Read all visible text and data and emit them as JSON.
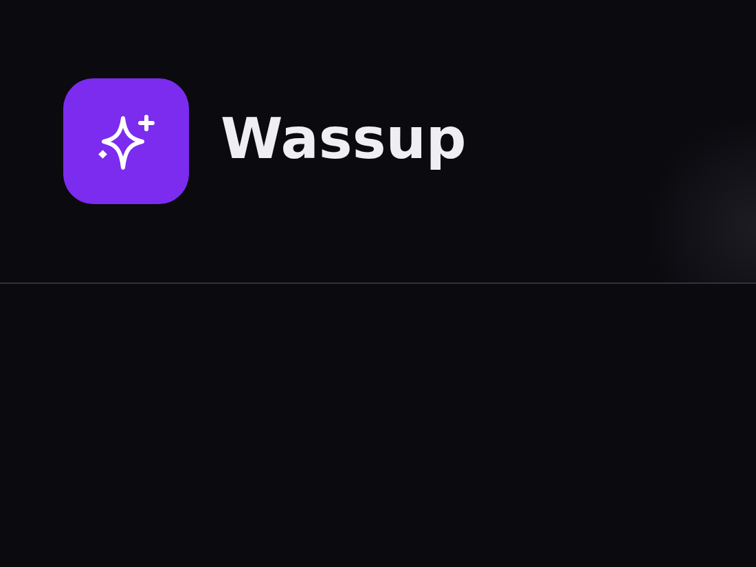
{
  "brand": {
    "name": "Wassup"
  }
}
